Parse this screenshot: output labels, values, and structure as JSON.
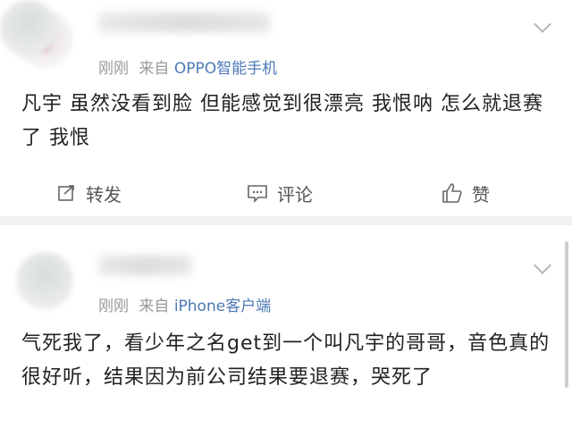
{
  "posts": [
    {
      "time": "刚刚",
      "source_prefix": "来自",
      "source": "OPPO智能手机",
      "content": "凡宇 虽然没看到脸 但能感觉到很漂亮 我恨呐 怎么就退赛了 我恨"
    },
    {
      "time": "刚刚",
      "source_prefix": "来自",
      "source": "iPhone客户端",
      "content": "气死我了，看少年之名get到一个叫凡宇的哥哥，音色真的很好听，结果因为前公司结果要退赛，哭死了"
    }
  ],
  "actions": {
    "repost": "转发",
    "comment": "评论",
    "like": "赞"
  },
  "icons": {
    "repost": "repost-icon",
    "comment": "comment-icon",
    "like": "thumbs-up-icon",
    "more": "chevron-down-icon"
  },
  "colors": {
    "source_link": "#4d79b5",
    "meta": "#9a9a9a",
    "background": "#f2f2f2"
  }
}
